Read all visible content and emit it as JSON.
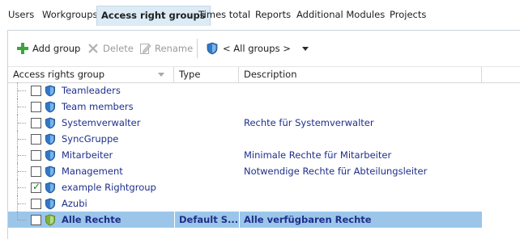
{
  "tabs": [
    {
      "label": "Users",
      "active": false
    },
    {
      "label": "Workgroups",
      "active": false
    },
    {
      "label": "Access right groups",
      "active": true
    },
    {
      "label": "Times total",
      "active": false
    },
    {
      "label": "Reports",
      "active": false
    },
    {
      "label": "Additional Modules",
      "active": false
    },
    {
      "label": "Projects",
      "active": false
    }
  ],
  "toolbar": {
    "add_label": "Add group",
    "delete_label": "Delete",
    "rename_label": "Rename",
    "group_filter_label": "< All groups >",
    "delete_enabled": false,
    "rename_enabled": false
  },
  "columns": {
    "name": "Access rights group",
    "type": "Type",
    "description": "Description"
  },
  "rows": [
    {
      "name": "Teamleaders",
      "type": "",
      "description": "",
      "checked": false,
      "selected": false
    },
    {
      "name": "Team members",
      "type": "",
      "description": "",
      "checked": false,
      "selected": false
    },
    {
      "name": "Systemverwalter",
      "type": "",
      "description": "Rechte für Systemverwalter",
      "checked": false,
      "selected": false
    },
    {
      "name": "SyncGruppe",
      "type": "",
      "description": "",
      "checked": false,
      "selected": false
    },
    {
      "name": "Mitarbeiter",
      "type": "",
      "description": "Minimale Rechte für Mitarbeiter",
      "checked": false,
      "selected": false
    },
    {
      "name": "Management",
      "type": "",
      "description": "Notwendige Rechte für Abteilungsleiter",
      "checked": false,
      "selected": false
    },
    {
      "name": "example Rightgroup",
      "type": "",
      "description": "",
      "checked": true,
      "selected": false
    },
    {
      "name": "Azubi",
      "type": "",
      "description": "",
      "checked": false,
      "selected": false
    },
    {
      "name": "Alle Rechte",
      "type": "Default S...",
      "description": "Alle verfügbaren Rechte",
      "checked": false,
      "selected": true
    }
  ],
  "colors": {
    "active_tab_bg": "#dcebf6",
    "link_text": "#1f2f8c",
    "selection_bg": "#9bc6ea",
    "shield_blue": "#2f79c8",
    "shield_green": "#7fb23a",
    "add_green": "#3aa63a"
  },
  "icons": {
    "add": "plus-icon",
    "delete": "x-icon",
    "rename": "edit-document-icon",
    "group_filter": "shield-icon",
    "dropdown": "chevron-down-icon",
    "row_blue": "shield-icon",
    "row_selected": "shield-green-icon"
  }
}
